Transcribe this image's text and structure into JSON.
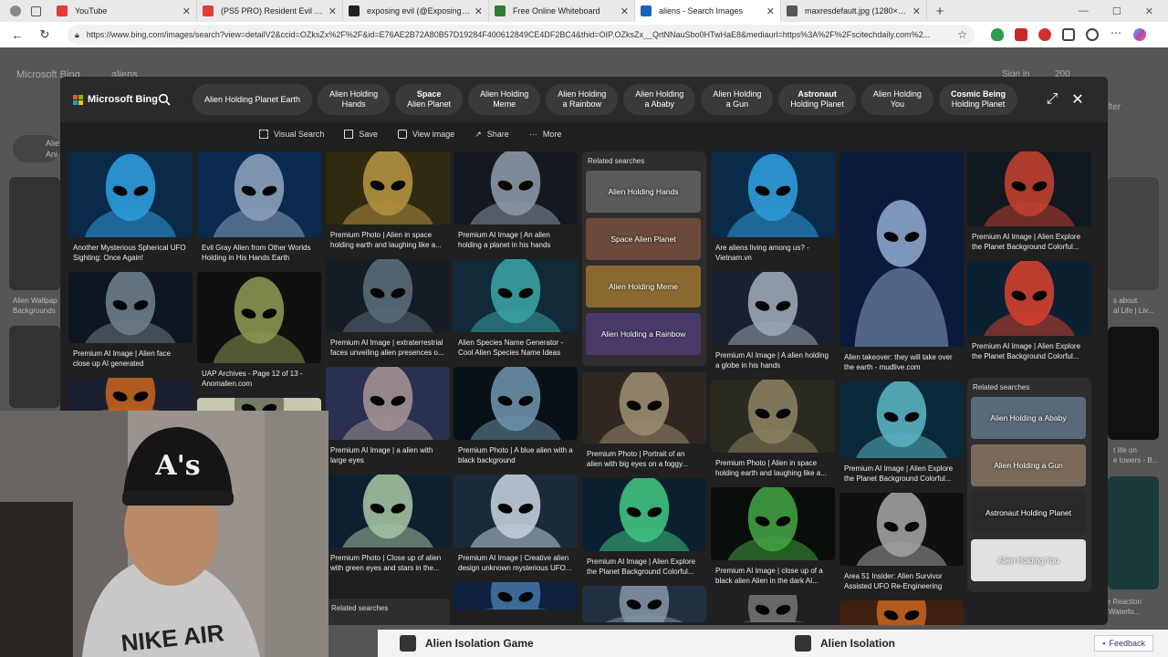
{
  "browser": {
    "tabs": [
      {
        "title": "YouTube",
        "color": "#e53935"
      },
      {
        "title": "(PS5 PRO) Resident Evil 3 Remake",
        "color": "#e53935"
      },
      {
        "title": "exposing evil (@Exposingevil917)",
        "color": "#222222"
      },
      {
        "title": "Free Online Whiteboard",
        "color": "#2e7d32"
      },
      {
        "title": "aliens - Search Images",
        "color": "#1565c0",
        "active": true
      },
      {
        "title": "maxresdefault.jpg (1280×720)",
        "color": "#555555"
      }
    ],
    "new_tab": "+",
    "url": "https://www.bing.com/images/search?view=detailV2&ccid=OZksZx%2F%2F&id=E76AE2B72A80B57D19284F400612849CE4DF2BC4&thid=OIP.OZksZx__QrtNNauSbo0HTwHaE8&mediaurl=https%3A%2F%2Fscitechdaily.com%2..."
  },
  "background_page": {
    "logo": "Microsoft Bing",
    "query": "aliens",
    "signin": "Sign in",
    "points": "200",
    "filter": "Filter",
    "side_left_top": "Alie",
    "side_left_top2": "Ani",
    "side_left_caption": "Alien Wallpap\nBackgrounds",
    "side_right_caption1": "s about\nal Life | Liv...",
    "side_right_caption2": "t life on\ne towers - B...",
    "side_right_caption3": "er Reaction\n- Waterfo..."
  },
  "modal": {
    "logo": "Microsoft Bing",
    "chips": [
      {
        "bold": "",
        "text": "Alien Holding Planet Earth"
      },
      {
        "bold": "",
        "text": "Alien Holding\nHands"
      },
      {
        "bold": "Space",
        "text": "Alien Planet"
      },
      {
        "bold": "",
        "text": "Alien Holding\nMeme"
      },
      {
        "bold": "",
        "text": "Alien Holding\na Rainbow"
      },
      {
        "bold": "",
        "text": "Alien Holding\na Ababy"
      },
      {
        "bold": "",
        "text": "Alien Holding\na Gun"
      },
      {
        "bold": "Astronaut",
        "text": "Holding Planet"
      },
      {
        "bold": "",
        "text": "Alien Holding\nYou"
      },
      {
        "bold": "Cosmic Being",
        "text": "Holding Planet"
      }
    ],
    "toolbar": {
      "visual_search": "Visual Search",
      "save": "Save",
      "view_image": "View image",
      "share": "Share",
      "more": "More"
    }
  },
  "results": {
    "col1": [
      {
        "caption": "Another Mysterious Spherical UFO Sighting: Once Again!",
        "bg": "#0a2a4a",
        "fg": "#2d9ad8"
      },
      {
        "caption": "Premium AI Image | Alien face close up AI generated",
        "bg": "#0e1620",
        "fg": "#6d7c86"
      },
      {
        "caption": "",
        "bg": "#1a2030",
        "fg": "#c06020"
      }
    ],
    "col2": [
      {
        "caption": "Evil Gray Alien from Other Worlds Holding in His Hands Earth Globe...",
        "bg": "#0a2a50",
        "fg": "#8aa0b8"
      },
      {
        "caption": "UAP Archives - Page 12 of 13 - Anomalien.com",
        "bg": "#101010",
        "fg": "#8c9450"
      },
      {
        "caption": "",
        "bg": "#c8c8b0",
        "fg": "#707060"
      }
    ],
    "col3": [
      {
        "caption": "Premium Photo | Alien in space holding earth and laughing like a...",
        "bg": "#302a10",
        "fg": "#b09040"
      },
      {
        "caption": "Premium AI Image | extraterrestrial faces unveiling alien presences o...",
        "bg": "#141c24",
        "fg": "#5a6a78"
      },
      {
        "caption": "Premium AI Image | a alien with large eyes",
        "bg": "#2a3050",
        "fg": "#a09090"
      },
      {
        "caption": "Premium Photo | Close up of alien with green eyes and stars in the...",
        "bg": "#0e2030",
        "fg": "#a0c0a0"
      }
    ],
    "col3_related": "Related searches",
    "col4": [
      {
        "caption": "Premium AI Image | An alien holding a planet in his hands",
        "bg": "#141820",
        "fg": "#8a96a4"
      },
      {
        "caption": "Alien Species Name Generator - Cool Alien Species Name Ideas",
        "bg": "#102a3a",
        "fg": "#3aa0a0"
      },
      {
        "caption": "Premium Photo | A blue alien with a black background",
        "bg": "#081018",
        "fg": "#6a90a8"
      },
      {
        "caption": "Premium AI Image | Creative alien design unknown mysterious UFO...",
        "bg": "#1a2a3a",
        "fg": "#c0ccd8"
      },
      {
        "caption": "",
        "bg": "#102040",
        "fg": "#4070a0"
      }
    ],
    "col5_related": {
      "title": "Related searches",
      "items": [
        {
          "label": "Alien Holding Hands",
          "bg": "#5a5a5a"
        },
        {
          "label": "Space Alien Planet",
          "bg": "#6a4a3a"
        },
        {
          "label": "Alien Holding Meme",
          "bg": "#8a6a30"
        },
        {
          "label": "Alien Holding a Rainbow",
          "bg": "#4a3a6a"
        }
      ]
    },
    "col5": [
      {
        "caption": "Premium Photo | Portrait of an alien with big eyes on a foggy...",
        "bg": "#302820",
        "fg": "#9a8a70"
      },
      {
        "caption": "Premium AI Image | Alien Explore the Planet Background Colorful...",
        "bg": "#0a2030",
        "fg": "#40c080"
      },
      {
        "caption": "",
        "bg": "#203040",
        "fg": "#8090a0"
      }
    ],
    "col6": [
      {
        "caption": "Are aliens living among us? - Vietnam.vn",
        "bg": "#0a2a4a",
        "fg": "#2d9ad8"
      },
      {
        "caption": "Premium AI Image | A alien holding a globe in his hands",
        "bg": "#1a2030",
        "fg": "#9aa6b4"
      },
      {
        "caption": "Premium Photo | Alien in space holding earth and laughing like a...",
        "bg": "#2a2a20",
        "fg": "#8a8060"
      },
      {
        "caption": "Premium AI Image | close up of a black alien Alien in the dark AI...",
        "bg": "#0a0e0a",
        "fg": "#40a040"
      },
      {
        "caption": "",
        "bg": "#202020",
        "fg": "#707070"
      }
    ],
    "col7": [
      {
        "caption": "Alien takeover: they will take over the earth - mudlive.com",
        "bg": "#0a1a3a",
        "fg": "#8aa4c8"
      },
      {
        "caption": "Premium AI Image | Alien Explore the Planet Background Colorful...",
        "bg": "#0a2a3a",
        "fg": "#5ab0c0"
      },
      {
        "caption": "Area 51 Insider: Alien Survivor Assisted UFO Re-Engineering",
        "bg": "#101010",
        "fg": "#a0a0a0"
      },
      {
        "caption": "",
        "bg": "#402010",
        "fg": "#c06020"
      }
    ],
    "col8": [
      {
        "caption": "Premium AI Image | Alien Explore the Planet Background Colorful...",
        "bg": "#101820",
        "fg": "#c04030"
      },
      {
        "caption": "Premium AI Image | Alien Explore the Planet Background Colorful...",
        "bg": "#0a2030",
        "fg": "#d04030"
      }
    ],
    "col8_related": {
      "title": "Related searches",
      "items": [
        {
          "label": "Alien Holding a Ababy",
          "bg": "#5a6a7a"
        },
        {
          "label": "Alien Holding a Gun",
          "bg": "#7a6a5a"
        },
        {
          "label": "Astronaut Holding Planet",
          "bg": "#2a2a2a"
        },
        {
          "label": "Alien Holding You",
          "bg": "#e0e0e0"
        }
      ]
    }
  },
  "bottom_bar": {
    "item1": "Alien Isolation Game",
    "item2": "Alien Isolation",
    "feedback": "Feedback"
  },
  "webcam": {
    "cap_logo": "A's",
    "shirt_text": "NIKE AIR"
  }
}
